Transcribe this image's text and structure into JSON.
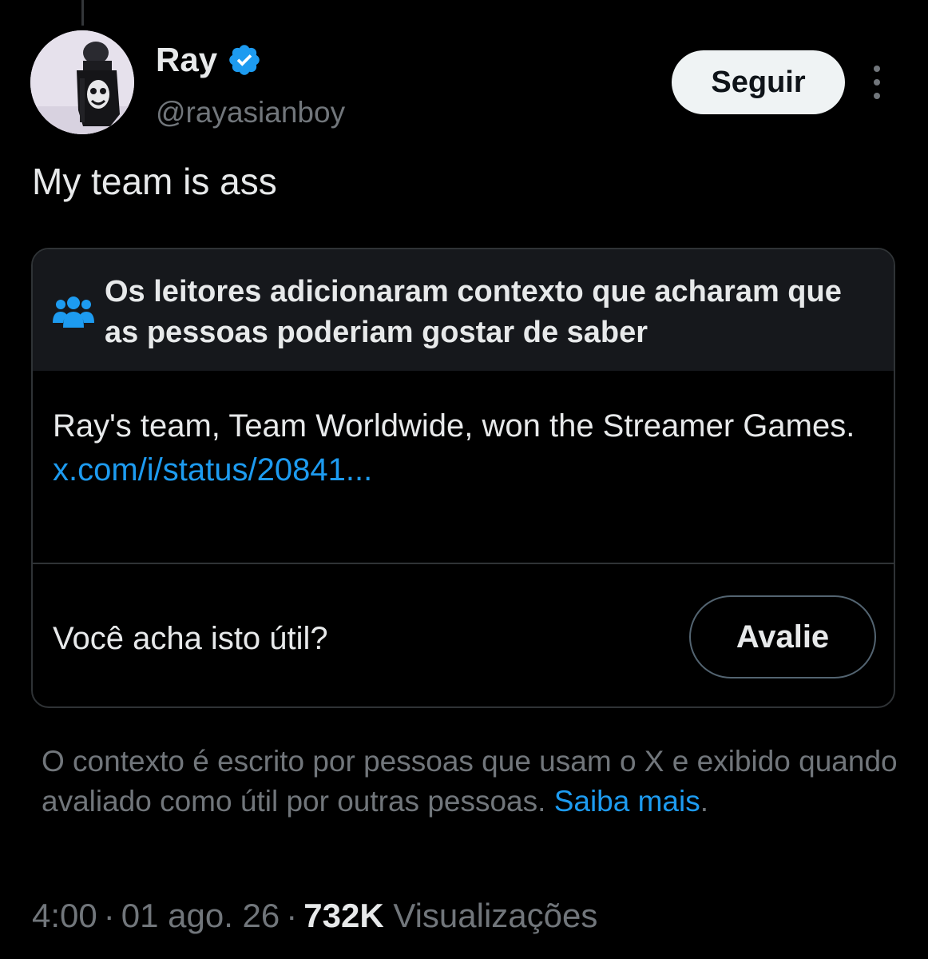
{
  "colors": {
    "background": "#000000",
    "primary_text": "#e7e9ea",
    "secondary_text": "#71767b",
    "accent_link": "#1d9bf0",
    "verified_badge": "#1d9bf0",
    "note_header_bg": "#16181c",
    "border": "#2f3336"
  },
  "tweet": {
    "author": {
      "display_name": "Ray",
      "handle": "@rayasianboy",
      "verified": true,
      "avatar_icon": "profile-photo"
    },
    "follow_label": "Seguir",
    "more_icon": "more-vertical-icon",
    "text": "My team is ass"
  },
  "community_note": {
    "header_icon": "people-icon",
    "header_text": "Os leitores adicionaram contexto que acharam que as pessoas poderiam gostar de saber",
    "body_text": "Ray's team, Team Worldwide, won the Streamer Games.",
    "link_text": "x.com/i/status/20841...",
    "question": "Você acha isto útil?",
    "rate_label": "Avalie"
  },
  "context_footer": {
    "text": "O contexto é escrito por pessoas que usam o X e exibido quando avaliado como útil por outras pessoas.",
    "learn_more": "Saiba mais",
    "trailing": "."
  },
  "meta": {
    "time": "4:00",
    "separator": "·",
    "date": "01 ago. 26",
    "views_count": "732K",
    "views_label": "Visualizações"
  }
}
